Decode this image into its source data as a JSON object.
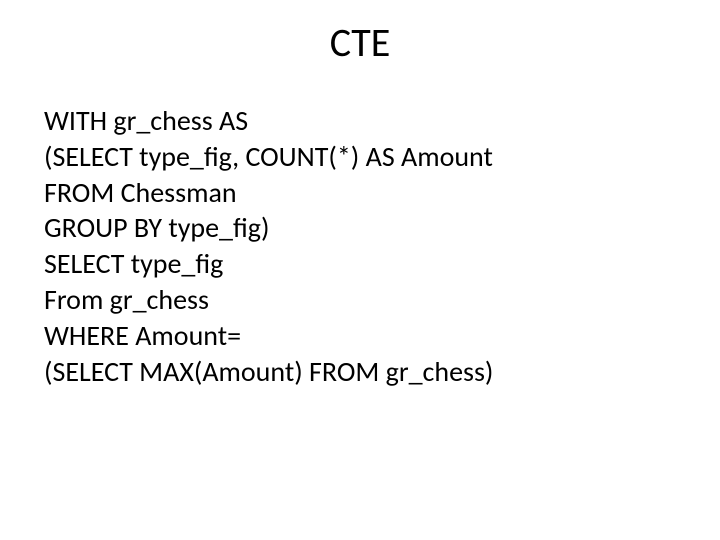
{
  "title": "CTE",
  "code": {
    "line1": "WITH gr_chess AS",
    "line2": "(SELECT type_fig, COUNT(*) AS Amount",
    "line3": "FROM Chessman",
    "line4": "GROUP BY type_fig)",
    "line5": "SELECT type_fig",
    "line6": "From gr_chess",
    "line7": "WHERE Amount=",
    "line8": "(SELECT MAX(Amount) FROM gr_chess)"
  }
}
